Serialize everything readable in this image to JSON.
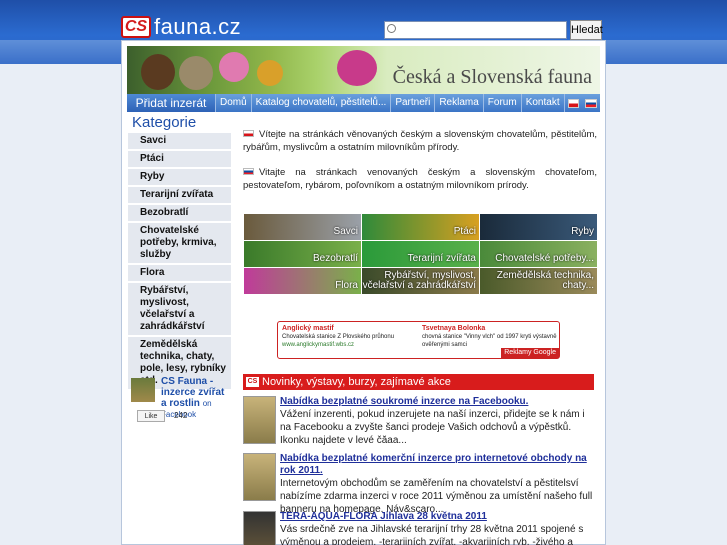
{
  "header": {
    "logo_mark": "CS",
    "logo_text": "fauna.cz",
    "search_placeholder": "",
    "search_button": "Hledat"
  },
  "banner": {
    "title": "Česká a Slovenská fauna"
  },
  "nav": {
    "add_label": "Přidat inzerát",
    "items": [
      "Domů",
      "Katalog chovatelů, pěstitelů...",
      "Partneři",
      "Reklama",
      "Forum",
      "Kontakt"
    ]
  },
  "sidebar": {
    "title": "Kategorie",
    "items": [
      "Savci",
      "Ptáci",
      "Ryby",
      "Terarijní zvířata",
      "Bezobratlí",
      "Chovatelské potřeby, krmiva, služby",
      "Flora",
      "Rybářství, myslivost, včelařství a zahrádkářství",
      "Zemědělská technika, chaty, pole, lesy, rybníky atd."
    ]
  },
  "facebook": {
    "name": "CS Fauna - inzerce zvířat a rostlin",
    "suffix": "on Facebook",
    "like": "Like",
    "count": "242"
  },
  "intro": {
    "cz": "Vítejte na stránkách věnovaných českým a slovenským chovatelům, pěstitelům, rybářům, myslivcům a ostatním milovníkům přírody.",
    "sk": "Vitajte na stránkach venovaných českým a slovenským chovateľom, pestovateľom, rybárom, poľovníkom a ostatným milovníkom prírody."
  },
  "tiles": [
    "Savci",
    "Ptáci",
    "Ryby",
    "Bezobratlí",
    "Terarijní zvířata",
    "Chovatelské potřeby...",
    "Flora",
    "Rybářství, myslivost, včelařství a zahrádkářství",
    "Zemědělská technika, chaty..."
  ],
  "ad": {
    "left_title": "Anglický mastif",
    "left_text": "Chovatelská stanice Z Plovského průhonu",
    "left_url": "www.anglickymastif.wbs.cz",
    "right_title": "Tsvetnaya Bolonka",
    "right_text": "chovná stanice \"Vinny vlch\" od 1997 kryti výstavně ověřenými samci",
    "label": "Reklamy Google"
  },
  "news": {
    "header": "Novinky, výstavy, burzy, zajímavé akce",
    "items": [
      {
        "title": "Nabídka bezplatné soukromé inzerce na Facebooku.",
        "text": "Vážení inzerenti, pokud inzerujete na naší inzerci, přidejte se k nám i na Facebooku a zvyšte šanci prodeje Vašich odchovů a výpěstků. Ikonku najdete v levé čăaa..."
      },
      {
        "title": "Nabídka bezplatné komerční inzerce pro internetové obchody na rok 2011.",
        "text": "Internetovým obchodům se zaměřením na chovatelství a pěstitelsví nabízíme zdarma inzerci v roce 2011 výměnou za umístění našeho full banneru na homepage. Náv&scaro..."
      },
      {
        "title": "TERA-AQUA-FLORA Jihlava 28 května 2011",
        "text": "Vás srdečně zve na Jihlavské terarijní trhy 28 května 2011 spojené s výměnou a prodejem, -terarijních zvířat, -akvarijních ryb, -živého a preparovaného"
      }
    ]
  },
  "colors": {
    "brand_blue": "#1f4fa8",
    "news_red": "#d81c1c"
  }
}
